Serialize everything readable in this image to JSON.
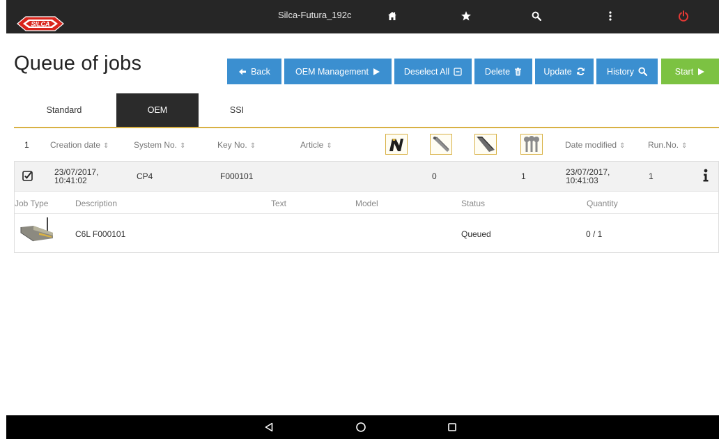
{
  "topbar": {
    "logo_text": "SILCA",
    "device_name": "Silca-Futura_192c",
    "icons": [
      "home-icon",
      "star-icon",
      "search-icon",
      "more-vert-icon",
      "power-icon"
    ],
    "colors": {
      "background": "#262626",
      "power": "#e53935",
      "logo": "#d9241b"
    }
  },
  "page": {
    "title": "Queue of jobs"
  },
  "toolbar": {
    "back": "Back",
    "oem_management": "OEM Management",
    "deselect_all": "Deselect All",
    "delete": "Delete",
    "update": "Update",
    "history": "History",
    "start": "Start",
    "colors": {
      "primary": "#3b8fd0",
      "start": "#7cc242"
    }
  },
  "tabs": [
    {
      "label": "Standard",
      "active": false
    },
    {
      "label": "OEM",
      "active": true
    },
    {
      "label": "SSI",
      "active": false
    }
  ],
  "table": {
    "count": "1",
    "columns": {
      "creation_date": "Creation date",
      "system_no": "System No.",
      "key_no": "Key No.",
      "article": "Article",
      "date_modified": "Date modified",
      "run_no": "Run.No."
    },
    "key_type_icons": [
      "dimple-key-icon",
      "flat-key-icon",
      "laser-key-icon",
      "multiple-keys-icon"
    ],
    "job": {
      "checked": true,
      "creation_date_line1": "23/07/2017,",
      "creation_date_line2": "10:41:02",
      "system_no": "CP4",
      "key_no": "F000101",
      "key_type2_value": "0",
      "key_type4_value": "1",
      "date_modified_line1": "23/07/2017,",
      "date_modified_line2": "10:41:03",
      "run_no": "1"
    },
    "detail_columns": {
      "job_type": "Job Type",
      "description": "Description",
      "text": "Text",
      "model": "Model",
      "status": "Status",
      "quantity": "Quantity"
    },
    "detail_row": {
      "description": "C6L F000101",
      "text": "",
      "model": "",
      "status": "Queued",
      "quantity": "0 / 1"
    }
  },
  "navbar": {
    "icons": [
      "back-triangle-icon",
      "home-circle-icon",
      "recents-square-icon"
    ]
  }
}
